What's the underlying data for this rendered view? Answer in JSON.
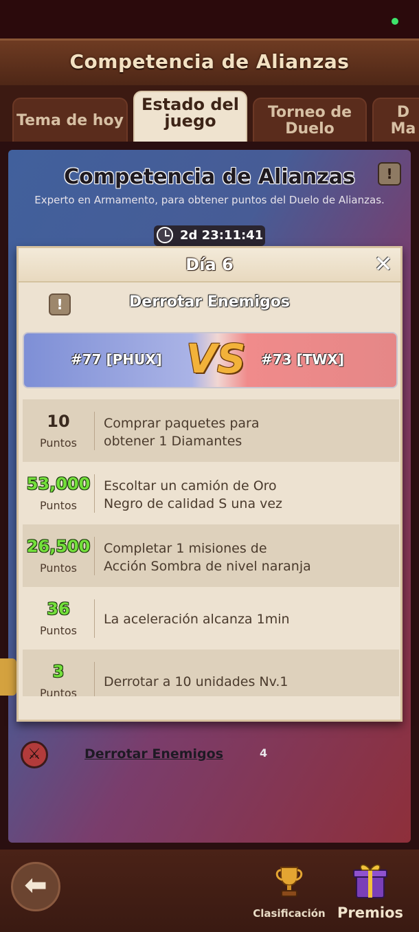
{
  "header": {
    "title": "Competencia de Alianzas"
  },
  "tabs": [
    {
      "label": "Tema de hoy"
    },
    {
      "label_line1": "Estado del",
      "label_line2": "juego"
    },
    {
      "label_line1": "Torneo de",
      "label_line2": "Duelo"
    },
    {
      "label_line1": "D",
      "label_line2": "Ma"
    }
  ],
  "background": {
    "title": "Competencia de Alianzas",
    "subtitle": "Experto en Armamento, para obtener puntos del Duelo de Alianzas.",
    "info_icon": "exclamation-icon",
    "timer": "2d 23:11:41",
    "defeat_label": "Derrotar Enemigos",
    "defeat_count": "4"
  },
  "dialog": {
    "title": "Día 6",
    "task_title": "Derrotar Enemigos",
    "left_team": "#77 [PHUX]",
    "right_team": "#73 [TWX]",
    "vs_text": "VS",
    "rows": [
      {
        "points": "10",
        "unit": "Puntos",
        "line1": "Comprar paquetes para",
        "line2": "obtener 1 Diamantes"
      },
      {
        "points": "53,000",
        "unit": "Puntos",
        "line1": "Escoltar un camión de Oro",
        "line2": "Negro de calidad S una vez"
      },
      {
        "points": "26,500",
        "unit": "Puntos",
        "line1": "Completar 1 misiones de",
        "line2": "Acción Sombra de nivel naranja"
      },
      {
        "points": "36",
        "unit": "Puntos",
        "line1": "La aceleración alcanza 1min"
      },
      {
        "points": "3",
        "unit": "Puntos",
        "line1": "Derrotar a 10 unidades Nv.1"
      }
    ]
  },
  "bottom_bar": {
    "ranking_label": "Clasificación",
    "prizes_label": "Premios"
  }
}
